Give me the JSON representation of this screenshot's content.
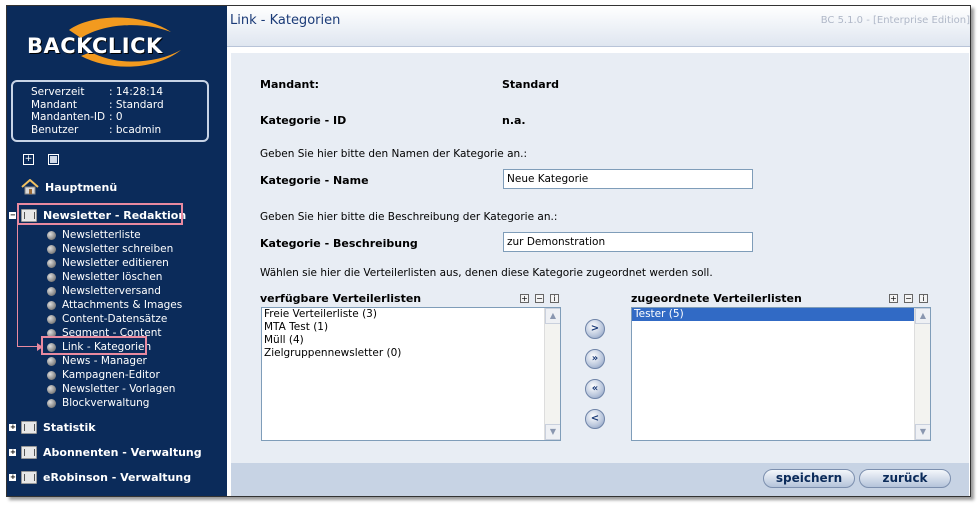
{
  "sidebar": {
    "logo": "BACKCLICK",
    "info": [
      {
        "k": "Serverzeit",
        "v": ": 14:28:14"
      },
      {
        "k": "Mandant",
        "v": ": Standard"
      },
      {
        "k": "Mandanten-ID",
        "v": ": 0"
      },
      {
        "k": "Benutzer",
        "v": ": bcadmin"
      }
    ],
    "home": "Hauptmenü",
    "active_section": "Newsletter - Redaktion",
    "items": [
      "Newsletterliste",
      "Newsletter schreiben",
      "Newsletter editieren",
      "Newsletter löschen",
      "Newsletterversand",
      "Attachments & Images",
      "Content-Datensätze",
      "Segment - Content",
      "Link - Kategorien",
      "News - Manager",
      "Kampagnen-Editor",
      "Newsletter - Vorlagen",
      "Blockverwaltung"
    ],
    "sections": [
      "Statistik",
      "Abonnenten - Verwaltung",
      "eRobinson - Verwaltung"
    ]
  },
  "header": {
    "title": "Link - Kategorien",
    "version": "BC 5.1.0 - [Enterprise Edition]"
  },
  "form": {
    "mandant_label": "Mandant:",
    "mandant_value": "Standard",
    "id_label": "Kategorie - ID",
    "id_value": "n.a.",
    "name_hint": "Geben Sie hier bitte den Namen der Kategorie an.:",
    "name_label": "Kategorie - Name",
    "name_value": "Neue Kategorie",
    "desc_hint": "Geben Sie hier bitte die Beschreibung der Kategorie an.:",
    "desc_label": "Kategorie - Beschreibung",
    "desc_value": "zur Demonstration",
    "lists_hint": "Wählen sie hier die Verteilerlisten aus, denen diese Kategorie zugeordnet werden soll."
  },
  "available": {
    "title": "verfügbare Verteilerlisten",
    "options": [
      "Freie Verteilerliste (3)",
      "MTA Test (1)",
      "Müll (4)",
      "Zielgruppennewsletter (0)"
    ]
  },
  "assigned": {
    "title": "zugeordnete Verteilerlisten",
    "options": [
      "Tester (5)"
    ]
  },
  "move_buttons": [
    ">",
    "»",
    "«",
    "<"
  ],
  "mini_icons": [
    "+",
    "−",
    "i"
  ],
  "footer": {
    "save": "speichern",
    "back": "zurück"
  }
}
